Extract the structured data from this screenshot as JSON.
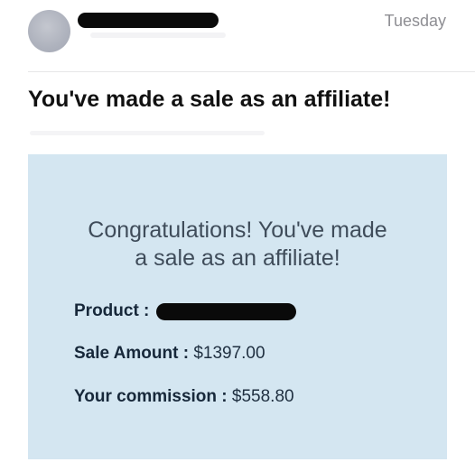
{
  "email": {
    "date": "Tuesday",
    "subject": "You've made a sale as an affiliate!"
  },
  "card": {
    "headline_line1": "Congratulations! You've made",
    "headline_line2": "a sale as an affiliate!",
    "product_label": "Product :",
    "sale_amount_label": "Sale Amount :",
    "sale_amount_value": "$1397.00",
    "commission_label": "Your commission :",
    "commission_value": "$558.80"
  },
  "colors": {
    "card_background": "#d4e6f1",
    "redaction": "#0a0a0a"
  }
}
